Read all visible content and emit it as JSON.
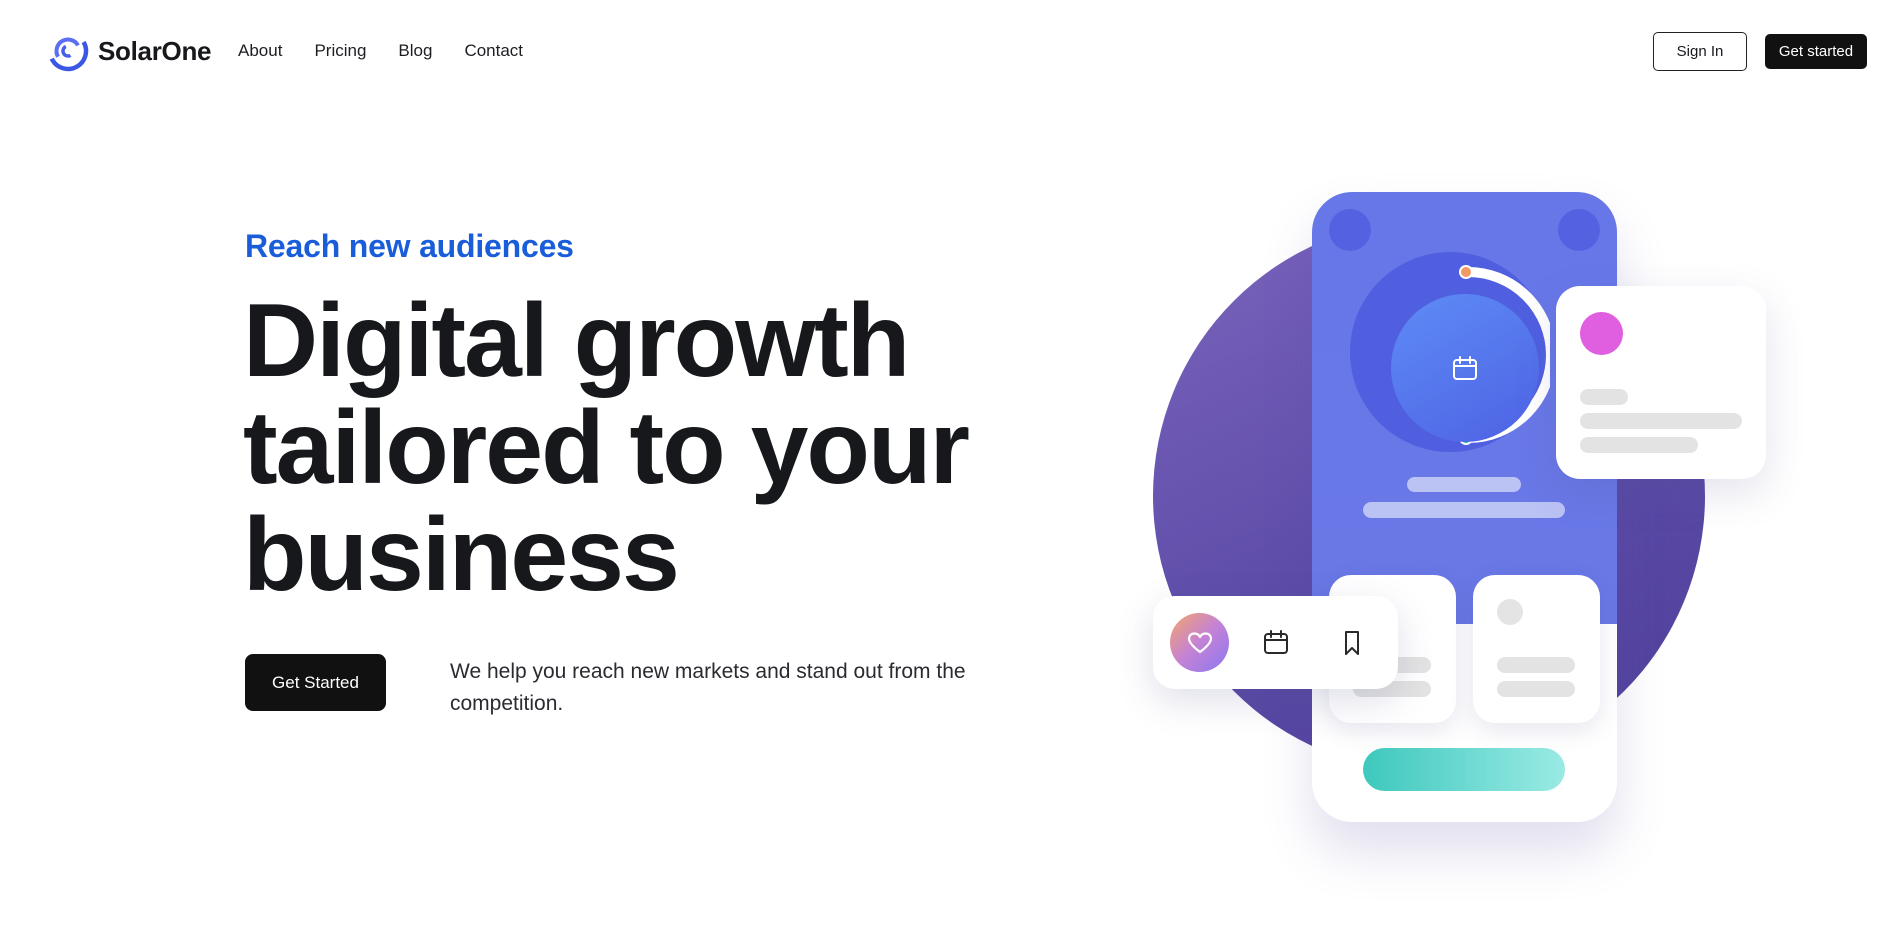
{
  "header": {
    "brand": "SolarOne",
    "logo_icon": "swirl-logo-icon",
    "nav": [
      {
        "label": "About"
      },
      {
        "label": "Pricing"
      },
      {
        "label": "Blog"
      },
      {
        "label": "Contact"
      }
    ],
    "sign_in_label": "Sign In",
    "get_started_label": "Get started"
  },
  "hero": {
    "eyebrow": "Reach new audiences",
    "headline_lines": [
      "Digital growth",
      "tailored to your",
      "business"
    ],
    "cta_label": "Get Started",
    "description": "We help you reach new markets and stand out from the competition."
  },
  "illustration": {
    "icons": [
      "calendar-icon",
      "heart-icon",
      "calendar-icon",
      "bookmark-icon"
    ],
    "colors": {
      "accent_blue": "#1a5ddb",
      "phone_blue": "#6777e8",
      "circle_purple": "#5a4aa6",
      "pink": "#e05ee0",
      "teal": "#3ec8bd",
      "orange": "#f4a56a"
    }
  }
}
